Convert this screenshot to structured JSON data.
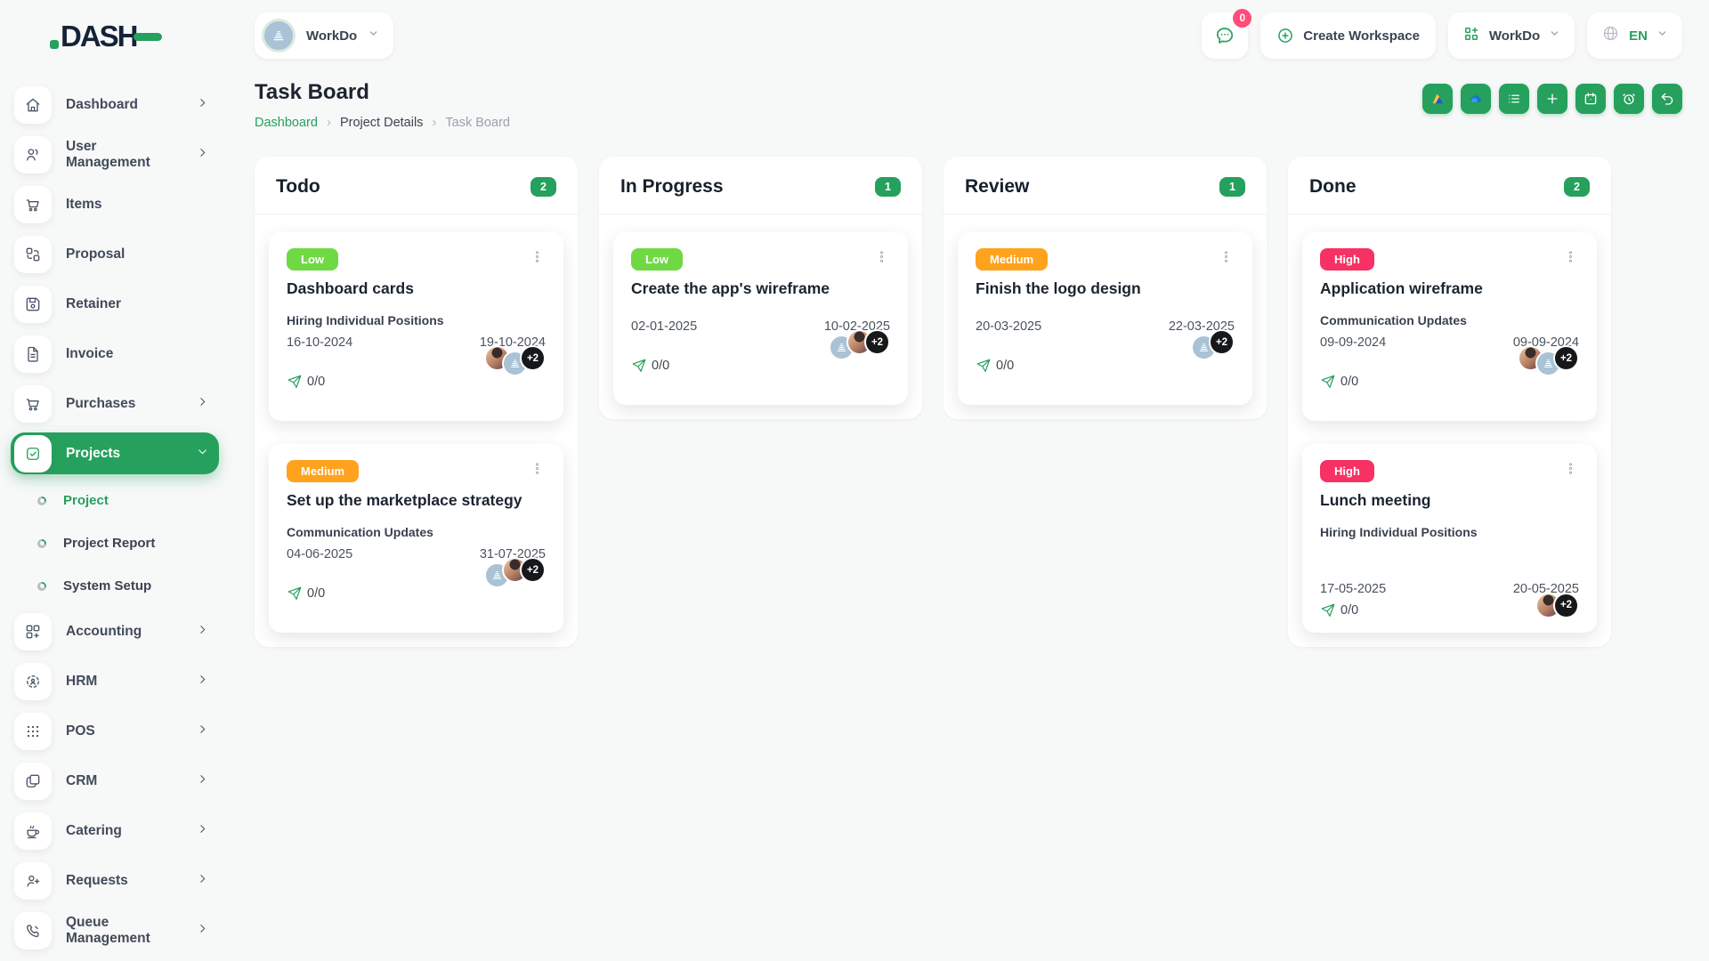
{
  "brand": {
    "name": "DASH"
  },
  "topbar": {
    "workspace": {
      "label": "WorkDo",
      "icon": "building-icon"
    },
    "messages": {
      "icon": "chat-icon",
      "badge": "0"
    },
    "create_workspace": {
      "label": "Create Workspace",
      "icon": "plus-circle-icon"
    },
    "app_menu": {
      "label": "WorkDo",
      "icon": "grid-plus-icon"
    },
    "language": {
      "label": "EN",
      "icon": "globe-icon"
    }
  },
  "sidebar": {
    "items": [
      {
        "label": "Dashboard",
        "icon": "home-icon"
      },
      {
        "label": "User Management",
        "icon": "users-icon"
      },
      {
        "label": "Items",
        "icon": "cart-icon"
      },
      {
        "label": "Proposal",
        "icon": "exchange-boxes-icon"
      },
      {
        "label": "Retainer",
        "icon": "floppy-icon"
      },
      {
        "label": "Invoice",
        "icon": "file-icon"
      },
      {
        "label": "Purchases",
        "icon": "cart-icon"
      },
      {
        "label": "Projects",
        "icon": "checkbox-icon"
      },
      {
        "label": "Project",
        "icon": "ring-bullet"
      },
      {
        "label": "Project Report",
        "icon": "ring-bullet"
      },
      {
        "label": "System Setup",
        "icon": "ring-bullet"
      },
      {
        "label": "Accounting",
        "icon": "grid-plus-icon"
      },
      {
        "label": "HRM",
        "icon": "crosshair-icon"
      },
      {
        "label": "POS",
        "icon": "dots-grid-icon"
      },
      {
        "label": "CRM",
        "icon": "copy-icon"
      },
      {
        "label": "Catering",
        "icon": "coffee-icon"
      },
      {
        "label": "Requests",
        "icon": "user-plus-icon"
      },
      {
        "label": "Queue Management",
        "icon": "phone-icon"
      }
    ]
  },
  "page": {
    "title": "Task Board",
    "breadcrumb": {
      "home": "Dashboard",
      "section": "Project Details",
      "current": "Task Board"
    }
  },
  "toolbar": {
    "buttons": [
      "google-drive",
      "onedrive",
      "list-view",
      "add-task",
      "calendar",
      "reminder",
      "back"
    ]
  },
  "board": {
    "columns": [
      {
        "name": "Todo",
        "count": "2",
        "cards": [
          {
            "priority": "Low",
            "title": "Dashboard cards",
            "milestone": "Hiring Individual Positions",
            "start_date": "16-10-2024",
            "end_date": "19-10-2024",
            "progress": "0/0",
            "avatars": [
              "user-photo",
              "workspace-logo"
            ],
            "more_assignees": "+2"
          },
          {
            "priority": "Medium",
            "title": "Set up the marketplace strategy",
            "milestone": "Communication Updates",
            "start_date": "04-06-2025",
            "end_date": "31-07-2025",
            "progress": "0/0",
            "avatars": [
              "workspace-logo",
              "user-photo"
            ],
            "more_assignees": "+2"
          }
        ]
      },
      {
        "name": "In Progress",
        "count": "1",
        "cards": [
          {
            "priority": "Low",
            "title": "Create the app's wireframe",
            "milestone": "",
            "start_date": "02-01-2025",
            "end_date": "10-02-2025",
            "progress": "0/0",
            "avatars": [
              "workspace-logo",
              "user-photo"
            ],
            "more_assignees": "+2"
          }
        ]
      },
      {
        "name": "Review",
        "count": "1",
        "cards": [
          {
            "priority": "Medium",
            "title": "Finish the logo design",
            "milestone": "",
            "start_date": "20-03-2025",
            "end_date": "22-03-2025",
            "progress": "0/0",
            "avatars": [
              "workspace-logo"
            ],
            "more_assignees": "+2"
          }
        ]
      },
      {
        "name": "Done",
        "count": "2",
        "cards": [
          {
            "priority": "High",
            "title": "Application wireframe",
            "milestone": "Communication Updates",
            "start_date": "09-09-2024",
            "end_date": "09-09-2024",
            "progress": "0/0",
            "avatars": [
              "user-photo",
              "workspace-logo"
            ],
            "more_assignees": "+2"
          },
          {
            "priority": "High",
            "title": "Lunch meeting",
            "milestone": "Hiring Individual Positions",
            "start_date": "17-05-2025",
            "end_date": "20-05-2025",
            "progress": "0/0",
            "avatars": [
              "user-photo"
            ],
            "more_assignees": "+2"
          }
        ]
      }
    ]
  },
  "colors": {
    "primary": "#26a05d",
    "priority_low": "#6fd943",
    "priority_medium": "#ffa21d",
    "priority_high": "#f73164",
    "notification_badge": "#ff4d79"
  }
}
